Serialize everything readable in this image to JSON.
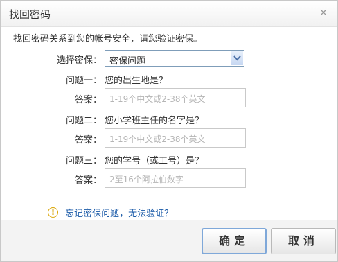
{
  "dialog": {
    "title": "找回密码",
    "close_icon": "close-icon",
    "intro": "找回密码关系到您的帐号安全，请您验证密保。"
  },
  "form": {
    "security_label": "选择密保：",
    "security_select": "密保问题",
    "q1_label": "问题一：",
    "q1_text": "您的出生地是？",
    "q2_label": "问题二：",
    "q2_text": "您小学班主任的名字是？",
    "q3_label": "问题三：",
    "q3_text": "您的学号（或工号）是？",
    "answer_label": "答案：",
    "a1_placeholder": "1-19个中文或2-38个英文",
    "a2_placeholder": "1-19个中文或2-38个英文",
    "a3_placeholder": "2至16个阿拉伯数字"
  },
  "forgot_link": "忘记密保问题，无法验证？",
  "buttons": {
    "ok": "确定",
    "cancel": "取消"
  }
}
